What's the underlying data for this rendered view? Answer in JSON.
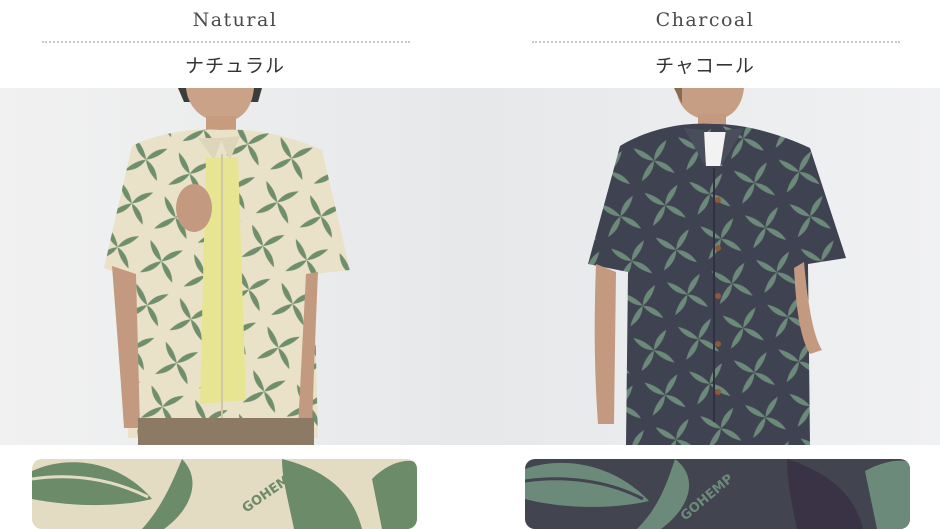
{
  "variants": [
    {
      "name_en": "Natural",
      "name_ja": "ナチュラル",
      "colors": {
        "shirt_base": "#e9e2c8",
        "leaf": "#6f8f6c",
        "tee": "#e7e591"
      }
    },
    {
      "name_en": "Charcoal",
      "name_ja": "チャコール",
      "colors": {
        "shirt_base": "#3f4250",
        "leaf": "#6c8a7a",
        "tee": "#f2f2f2"
      }
    }
  ],
  "swatch_print_text": "GOHEMP"
}
